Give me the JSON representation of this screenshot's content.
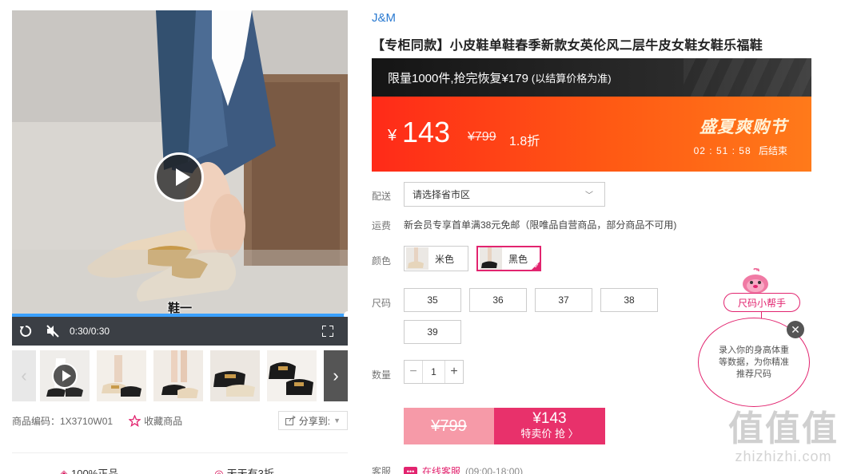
{
  "video": {
    "subtitle": "鞋一",
    "time": "0:30/0:30",
    "progress_fraction": 1.0
  },
  "thumbnails": {
    "count": 7
  },
  "meta": {
    "sku_label": "商品编码：1X3710W01",
    "favorite_label": "收藏商品",
    "share_label": "分享到:"
  },
  "promises": [
    "100%正品",
    "天天有3折"
  ],
  "product": {
    "brand": "J&M",
    "title": "【专柜同款】小皮鞋单鞋春季新款女英伦风二层牛皮女鞋女鞋乐福鞋"
  },
  "limit_banner": {
    "main": "限量1000件,抢完恢复¥179",
    "note": "(以结算价格为准)"
  },
  "price": {
    "currency": "¥",
    "current": "143",
    "original": "¥799",
    "discount": "1.8折",
    "event_name": "盛夏爽购节",
    "countdown": "02 : 51 : 58",
    "countdown_suffix": "后结束"
  },
  "delivery": {
    "label": "配送",
    "placeholder": "请选择省市区"
  },
  "shipping": {
    "label": "运费",
    "text": "新会员专享首单满38元免邮（限唯品自营商品，部分商品不可用)"
  },
  "colors": {
    "label": "颜色",
    "options": [
      "米色",
      "黑色"
    ],
    "selected": "黑色"
  },
  "sizes": {
    "label": "尺码",
    "options": [
      "35",
      "36",
      "37",
      "38",
      "39"
    ]
  },
  "quantity": {
    "label": "数量",
    "value": "1"
  },
  "buy": {
    "original": "¥799",
    "price": "¥143",
    "cta": "特卖价 抢 〉"
  },
  "service": {
    "label": "客服",
    "link": "在线客服",
    "hours": "(09:00-18:00)"
  },
  "size_helper": {
    "tag": "尺码小帮手",
    "bubble": "录入你的身高体重等数据，为你精准推荐尺码"
  },
  "watermark": {
    "big": "值值值",
    "url": "zhizhizhi.com"
  },
  "colors_theme": {
    "accent": "#e2246f",
    "price_orange": "#ff4a16",
    "brand_blue": "#2a7ad1"
  }
}
